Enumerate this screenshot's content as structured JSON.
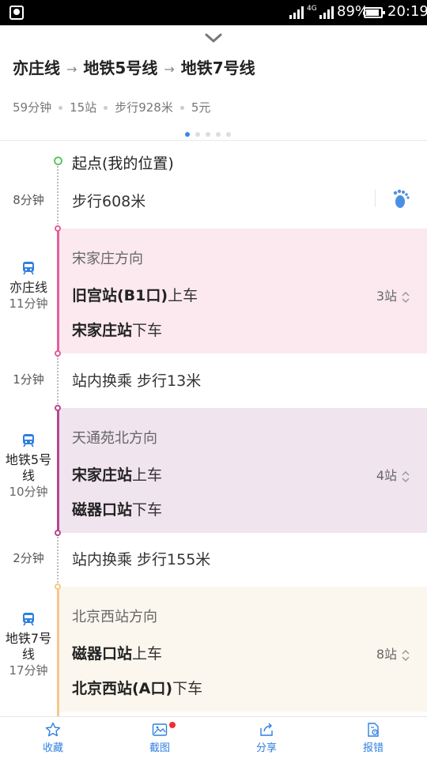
{
  "status_bar": {
    "network": "4G",
    "battery": "89%",
    "time": "20:19"
  },
  "header": {
    "route": {
      "line1": "亦庄线",
      "line2": "地铁5号线",
      "line3": "地铁7号线"
    },
    "summary": {
      "duration": "59分钟",
      "stations": "15站",
      "walk": "步行928米",
      "fare": "5元"
    }
  },
  "steps": {
    "start": {
      "label": "起点(我的位置)",
      "walk_time": "8分钟",
      "walk_text": "步行608米"
    },
    "seg1": {
      "line": "亦庄线",
      "time": "11分钟",
      "direction": "宋家庄方向",
      "board_station": "旧宫站(B1口)",
      "board_suffix": "上车",
      "stops": "3站",
      "alight_station": "宋家庄站",
      "alight_suffix": "下车",
      "color": "#e0609a",
      "bg": "#fbe9ef"
    },
    "transfer1": {
      "time": "1分钟",
      "text": "站内换乘 步行13米"
    },
    "seg2": {
      "line_a": "地铁5号",
      "line_b": "线",
      "time": "10分钟",
      "direction": "天通苑北方向",
      "board_station": "宋家庄站",
      "board_suffix": "上车",
      "stops": "4站",
      "alight_station": "磁器口站",
      "alight_suffix": "下车",
      "color": "#b8468f",
      "bg": "#f0e4ee"
    },
    "transfer2": {
      "time": "2分钟",
      "text": "站内换乘 步行155米"
    },
    "seg3": {
      "line_a": "地铁7号",
      "line_b": "线",
      "time": "17分钟",
      "direction": "北京西站方向",
      "board_station": "磁器口站",
      "board_suffix": "上车",
      "stops": "8站",
      "alight_station": "北京西站(A口)",
      "alight_suffix": "下车",
      "color": "#f5c88a",
      "bg": "#fbf7ee"
    }
  },
  "bottom_bar": {
    "favorite": "收藏",
    "screenshot": "截图",
    "share": "分享",
    "report": "报错"
  },
  "colors": {
    "accent": "#2f7fe0",
    "start_green": "#5cc85c",
    "badge_red": "#f03030"
  }
}
